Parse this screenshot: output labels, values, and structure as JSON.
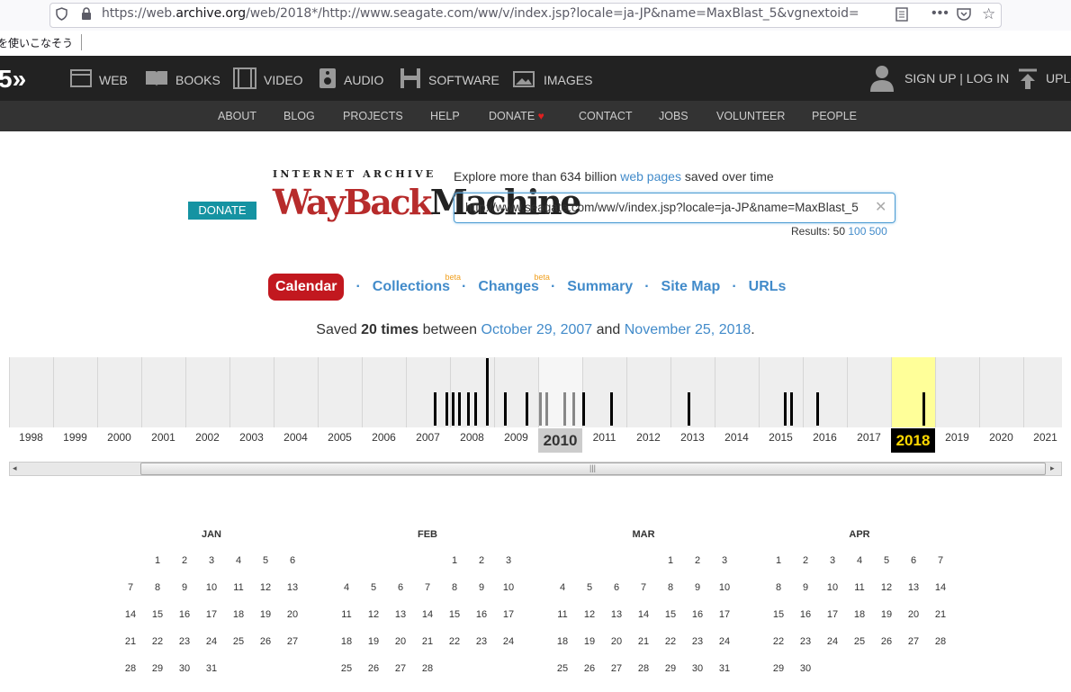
{
  "browser": {
    "url_prefix": "https://web.",
    "url_domain": "archive.org",
    "url_rest": "/web/2018*/http://www.seagate.com/ww/v/index.jsp?locale=ja-JP&name=MaxBlast_5&vgnextoid=",
    "bookmark": "を使いこなそう"
  },
  "topnav": {
    "logo": "5",
    "items": [
      "WEB",
      "BOOKS",
      "VIDEO",
      "AUDIO",
      "SOFTWARE",
      "IMAGES"
    ],
    "account": "SIGN UP | LOG IN",
    "upload": "UPLO"
  },
  "subnav": [
    "ABOUT",
    "BLOG",
    "PROJECTS",
    "HELP",
    "DONATE",
    "CONTACT",
    "JOBS",
    "VOLUNTEER",
    "PEOPLE"
  ],
  "wayback": {
    "donate": "DONATE",
    "logo_top": "INTERNET ARCHIVE",
    "logo_w": "WayBack",
    "logo_m": "Machine",
    "explore_pre": "Explore more than 634 billion ",
    "explore_link": "web pages",
    "explore_post": " saved over time",
    "search_value": "http://www.seagate.com/ww/v/index.jsp?locale=ja-JP&name=MaxBlast_5",
    "results_label": "Results: 50",
    "results_100": "100",
    "results_500": "500"
  },
  "tabs": [
    {
      "label": "Calendar",
      "active": true
    },
    {
      "label": "Collections",
      "beta": "beta"
    },
    {
      "label": "Changes",
      "beta": "beta"
    },
    {
      "label": "Summary"
    },
    {
      "label": "Site Map"
    },
    {
      "label": "URLs"
    }
  ],
  "saved": {
    "pre": "Saved ",
    "count": "20 times",
    "mid": " between ",
    "start": "October 29, 2007",
    "and": " and ",
    "end": "November 25, 2018",
    "dot": "."
  },
  "years": [
    "1998",
    "1999",
    "2000",
    "2001",
    "2002",
    "2003",
    "2004",
    "2005",
    "2006",
    "2007",
    "2008",
    "2009",
    "2010",
    "2011",
    "2012",
    "2013",
    "2014",
    "2015",
    "2016",
    "2017",
    "2018",
    "2019",
    "2020",
    "2021"
  ],
  "selected_year": "2018",
  "hover_year": "2010",
  "months": [
    {
      "name": "JAN",
      "offset": 1,
      "days": 31
    },
    {
      "name": "FEB",
      "offset": 4,
      "days": 28
    },
    {
      "name": "MAR",
      "offset": 4,
      "days": 31
    },
    {
      "name": "APR",
      "offset": 0,
      "days": 30
    }
  ],
  "colors": {
    "selected": "#ffff99",
    "selected_label_bg": "#000",
    "selected_label_fg": "#ffd800"
  }
}
